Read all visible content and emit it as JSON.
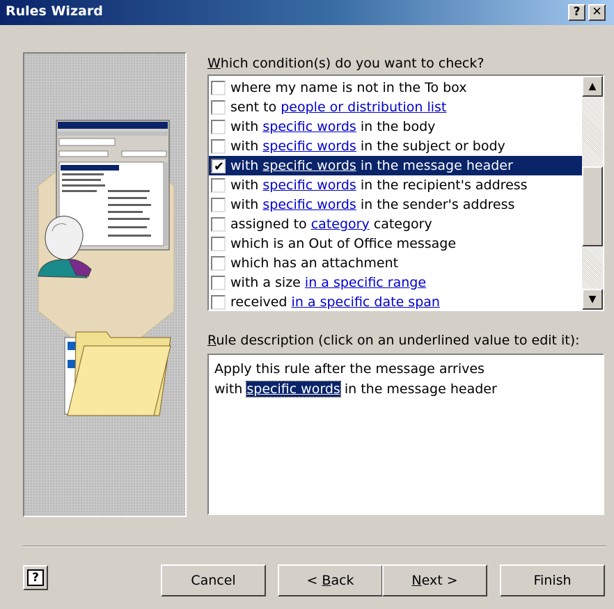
{
  "window": {
    "title": "Rules Wizard",
    "help_button": "?",
    "close_button": "✕"
  },
  "conditions": {
    "label_prefix": "",
    "label_hotkey": "W",
    "label_rest": "hich condition(s) do you want to check?",
    "items": [
      {
        "pre": "where my name is not in the To box",
        "link": "",
        "post": "",
        "checked": false,
        "selected": false
      },
      {
        "pre": "sent to ",
        "link": "people or distribution list",
        "post": "",
        "checked": false,
        "selected": false
      },
      {
        "pre": "with ",
        "link": "specific words",
        "post": " in the body",
        "checked": false,
        "selected": false
      },
      {
        "pre": "with ",
        "link": "specific words",
        "post": " in the subject or body",
        "checked": false,
        "selected": false
      },
      {
        "pre": "with ",
        "link": "specific words",
        "post": " in the message header",
        "checked": true,
        "selected": true
      },
      {
        "pre": "with ",
        "link": "specific words",
        "post": " in the recipient's address",
        "checked": false,
        "selected": false
      },
      {
        "pre": "with ",
        "link": "specific words",
        "post": " in the sender's address",
        "checked": false,
        "selected": false
      },
      {
        "pre": "assigned to ",
        "link": "category",
        "post": " category",
        "checked": false,
        "selected": false
      },
      {
        "pre": "which is an Out of Office message",
        "link": "",
        "post": "",
        "checked": false,
        "selected": false
      },
      {
        "pre": "which has an attachment",
        "link": "",
        "post": "",
        "checked": false,
        "selected": false
      },
      {
        "pre": "with a size ",
        "link": "in a specific range",
        "post": "",
        "checked": false,
        "selected": false
      },
      {
        "pre": "received ",
        "link": "in a specific date span",
        "post": "",
        "checked": false,
        "selected": false
      }
    ]
  },
  "scrollbar": {
    "up_glyph": "▲",
    "down_glyph": "▼"
  },
  "description": {
    "label_hotkey": "R",
    "label_rest": "ule description (click on an underlined value to edit it):",
    "line1": "Apply this rule after the message arrives",
    "line2_pre": "with ",
    "line2_link": "specific words",
    "line2_post": " in the message header"
  },
  "buttons": {
    "help_icon": "?",
    "cancel": "Cancel",
    "back_pre": "< ",
    "back_hotkey": "B",
    "back_rest": "ack",
    "next_hotkey": "N",
    "next_rest": "ext >",
    "finish": "Finish"
  },
  "colors": {
    "face": "#d4d0c8",
    "selection": "#0a246a",
    "link": "#0000cc",
    "title_gradient_start": "#0a246a",
    "title_gradient_end": "#a6caf0"
  }
}
